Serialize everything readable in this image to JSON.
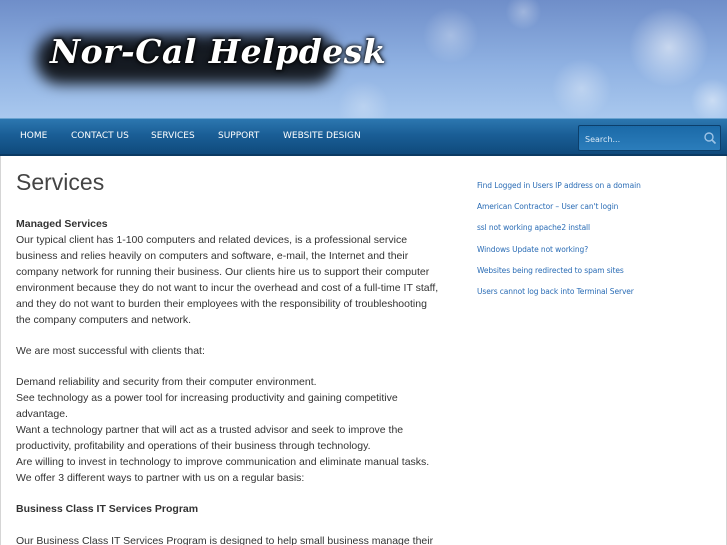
{
  "header": {
    "site_title": "Nor-Cal Helpdesk"
  },
  "nav": {
    "items": [
      {
        "label": "HOME"
      },
      {
        "label": "CONTACT US"
      },
      {
        "label": "SERVICES"
      },
      {
        "label": "SUPPORT"
      },
      {
        "label": "WEBSITE DESIGN"
      }
    ],
    "search_placeholder": "Search..."
  },
  "main": {
    "title": "Services",
    "lines": [
      "Managed Services",
      "Our typical client has 1-100 computers and related devices, is a professional service",
      "business and relies heavily on computers and software, e-mail, the Internet and their",
      "company network for running their business. Our clients hire us to support their computer",
      "environment because they do not want to incur the overhead and cost of a full-time IT staff,",
      "and they do not want to burden their employees with the responsibility of troubleshooting",
      "the company computers and network.",
      "We are most successful with clients that:",
      "Demand reliability and security from their computer environment.",
      "See technology as a power tool for increasing productivity and gaining competitive",
      "advantage.",
      "Want a technology partner that will act as a trusted advisor and seek to improve the",
      "productivity, profitability and operations of their business through technology.",
      "Are willing to invest in technology to improve communication and eliminate manual tasks.",
      "We offer 3 different ways to partner with us on a regular basis:",
      "Business Class IT Services Program",
      "Our Business Class IT Services Program is designed to help small business manage their"
    ]
  },
  "sidebar": {
    "links": [
      {
        "label": "Find Logged in Users IP address on a domain"
      },
      {
        "label": "American Contractor – User can't login"
      },
      {
        "label": "ssl not working apache2 install"
      },
      {
        "label": "Windows Update not working?"
      },
      {
        "label": "Websites being redirected to spam sites"
      },
      {
        "label": "Users cannot log back into Terminal Server"
      }
    ]
  },
  "colors": {
    "nav_background": "#1a5e96",
    "link": "#2a6cb5",
    "header_sky": "#8fb1e2"
  }
}
